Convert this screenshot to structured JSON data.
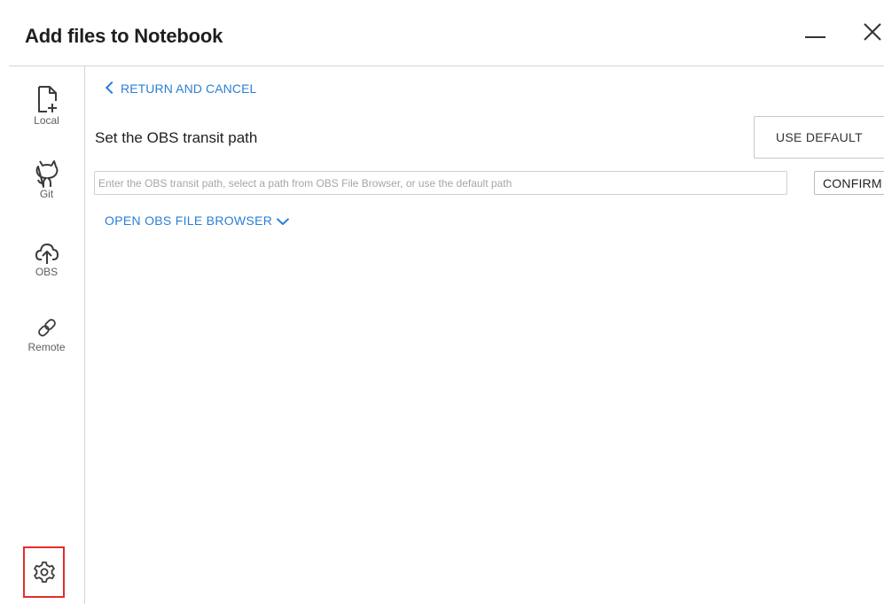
{
  "dialog": {
    "title": "Add files to Notebook"
  },
  "sidebar": {
    "items": [
      {
        "label": "Local",
        "icon": "file-add-icon"
      },
      {
        "label": "Git",
        "icon": "github-icon"
      },
      {
        "label": "OBS",
        "icon": "cloud-upload-icon"
      },
      {
        "label": "Remote",
        "icon": "link-icon"
      }
    ],
    "settings_icon": "gear-icon"
  },
  "main": {
    "return_label": "RETURN AND CANCEL",
    "section_title": "Set the OBS transit path",
    "use_default_label": "USE DEFAULT",
    "path_input": {
      "value": "",
      "placeholder": "Enter the OBS transit path, select a path from OBS File Browser, or use the default path"
    },
    "confirm_label": "CONFIRM",
    "open_browser_label": "OPEN OBS FILE BROWSER"
  },
  "colors": {
    "link": "#2a7fd6",
    "highlight_border": "#e32d2d",
    "divider": "#d4d4d4"
  }
}
